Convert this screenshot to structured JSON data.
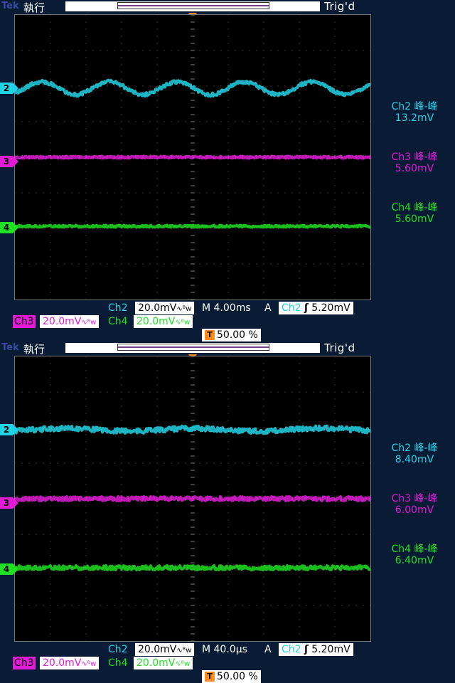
{
  "scopes": [
    {
      "brand": "Tek",
      "run_state": "執行",
      "trig_state": "Trig'd",
      "trigger_marker": "T",
      "channels": [
        {
          "id": "2",
          "color": "#22d3e6",
          "label": "Ch2 峰-峰",
          "value": "13.2mV",
          "scale": "20.0mV"
        },
        {
          "id": "3",
          "color": "#e21bd6",
          "label": "Ch3 峰-峰",
          "value": "5.60mV",
          "scale": "20.0mV"
        },
        {
          "id": "4",
          "color": "#20e022",
          "label": "Ch4 峰-峰",
          "value": "5.60mV",
          "scale": "20.0mV"
        }
      ],
      "ch2_name": "Ch2",
      "ch3_name": "Ch3",
      "ch4_name": "Ch4",
      "bw_symbol": "∿ᴮw",
      "timebase": "M 4.00ms",
      "acq_mode": "A",
      "trig_source": "Ch2",
      "trig_slope": "ʃ",
      "trig_level": "5.20mV",
      "trig_pos_icon": "T",
      "trig_pos": "50.00 %"
    },
    {
      "brand": "Tek",
      "run_state": "執行",
      "trig_state": "Trig'd",
      "trigger_marker": "T",
      "channels": [
        {
          "id": "2",
          "color": "#22d3e6",
          "label": "Ch2 峰-峰",
          "value": "8.40mV",
          "scale": "20.0mV"
        },
        {
          "id": "3",
          "color": "#e21bd6",
          "label": "Ch3 峰-峰",
          "value": "6.00mV",
          "scale": "20.0mV"
        },
        {
          "id": "4",
          "color": "#20e022",
          "label": "Ch4 峰-峰",
          "value": "6.40mV",
          "scale": "20.0mV"
        }
      ],
      "ch2_name": "Ch2",
      "ch3_name": "Ch3",
      "ch4_name": "Ch4",
      "bw_symbol": "∿ᴮw",
      "timebase": "M 40.0µs",
      "acq_mode": "A",
      "trig_source": "Ch2",
      "trig_slope": "ʃ",
      "trig_level": "5.20mV",
      "trig_pos_icon": "T",
      "trig_pos": "50.00 %"
    }
  ],
  "colors": {
    "background": "#0a1b36",
    "grid": "#5a5a5a",
    "ch2": "#22d3e6",
    "ch3": "#e21bd6",
    "ch4": "#20e022",
    "trigger": "#ff8a20"
  }
}
